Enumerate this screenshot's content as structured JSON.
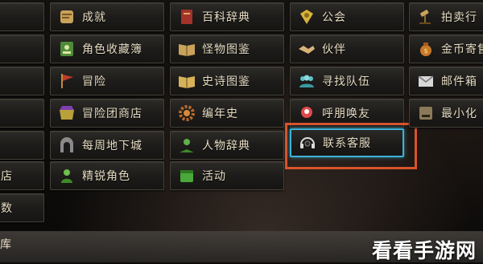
{
  "menu": {
    "col1": [
      "成就",
      "角色收藏簿",
      "冒险",
      "冒险团商店",
      "每周地下城",
      "精锐角色"
    ],
    "col2": [
      "百科辞典",
      "怪物图鉴",
      "史诗图鉴",
      "编年史",
      "人物辞典",
      "活动"
    ],
    "col3": [
      "公会",
      "伙伴",
      "寻找队伍",
      "呼朋唤友",
      "联系客服"
    ],
    "col4": [
      "拍卖行",
      "金币寄售",
      "邮件箱",
      "最小化"
    ],
    "edge": [
      "店",
      "数"
    ]
  },
  "bottom_bar": {
    "left_label": "库"
  },
  "watermark": "看看手游网",
  "colors": {
    "highlight_frame": "#d9532b",
    "highlight_tile": "#3fb3d6"
  }
}
